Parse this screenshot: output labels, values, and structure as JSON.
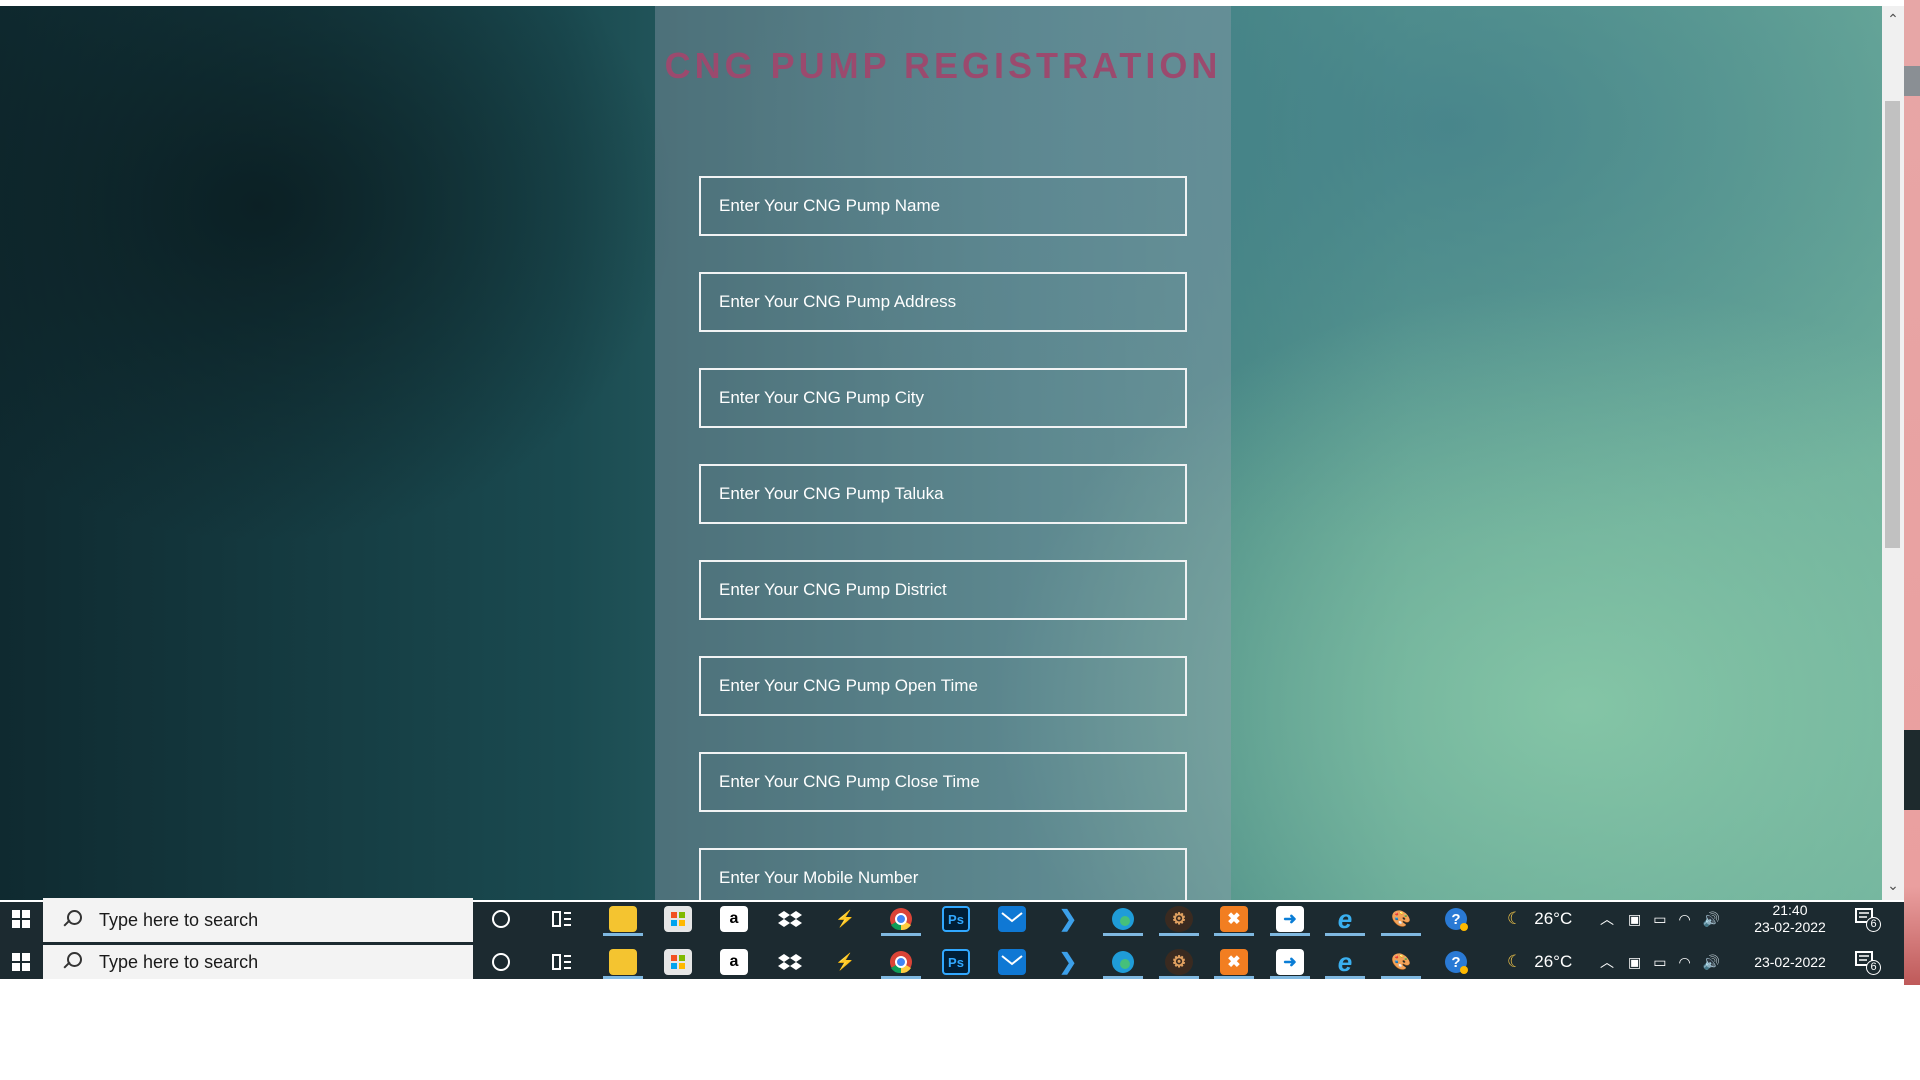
{
  "form": {
    "title": "CNG PUMP REGISTRATION",
    "fields": [
      {
        "name": "pump-name-input",
        "placeholder": "Enter Your CNG Pump Name"
      },
      {
        "name": "pump-address-input",
        "placeholder": "Enter Your CNG Pump Address"
      },
      {
        "name": "pump-city-input",
        "placeholder": "Enter Your CNG Pump City"
      },
      {
        "name": "pump-taluka-input",
        "placeholder": "Enter Your CNG Pump Taluka"
      },
      {
        "name": "pump-district-input",
        "placeholder": "Enter Your CNG Pump District"
      },
      {
        "name": "pump-open-time-input",
        "placeholder": "Enter Your CNG Pump Open Time"
      },
      {
        "name": "pump-close-time-input",
        "placeholder": "Enter Your CNG Pump Close Time"
      },
      {
        "name": "mobile-number-input",
        "placeholder": "Enter Your Mobile Number"
      }
    ]
  },
  "scrollbar": {
    "up": "⌃",
    "down": "⌄"
  },
  "taskbar": {
    "search_placeholder": "Type here to search",
    "apps": [
      "cortana-icon",
      "task-view-icon",
      "file-explorer-icon",
      "store-icon",
      "amazon-icon",
      "dropbox-icon",
      "sublime-icon",
      "chrome-icon",
      "photoshop-icon",
      "mail-icon",
      "vscode-icon",
      "edge-icon",
      "gear-app-icon",
      "xampp-icon",
      "remote-icon",
      "internet-explorer-icon",
      "paint-icon",
      "help-icon"
    ],
    "weather": "26°C",
    "time_top": "21:40",
    "date": "23-02-2022",
    "notifications": "6"
  },
  "colors": {
    "title": "#9b4a6e",
    "field_border": "#f1f3f4",
    "taskbar": "#1c2a30"
  }
}
